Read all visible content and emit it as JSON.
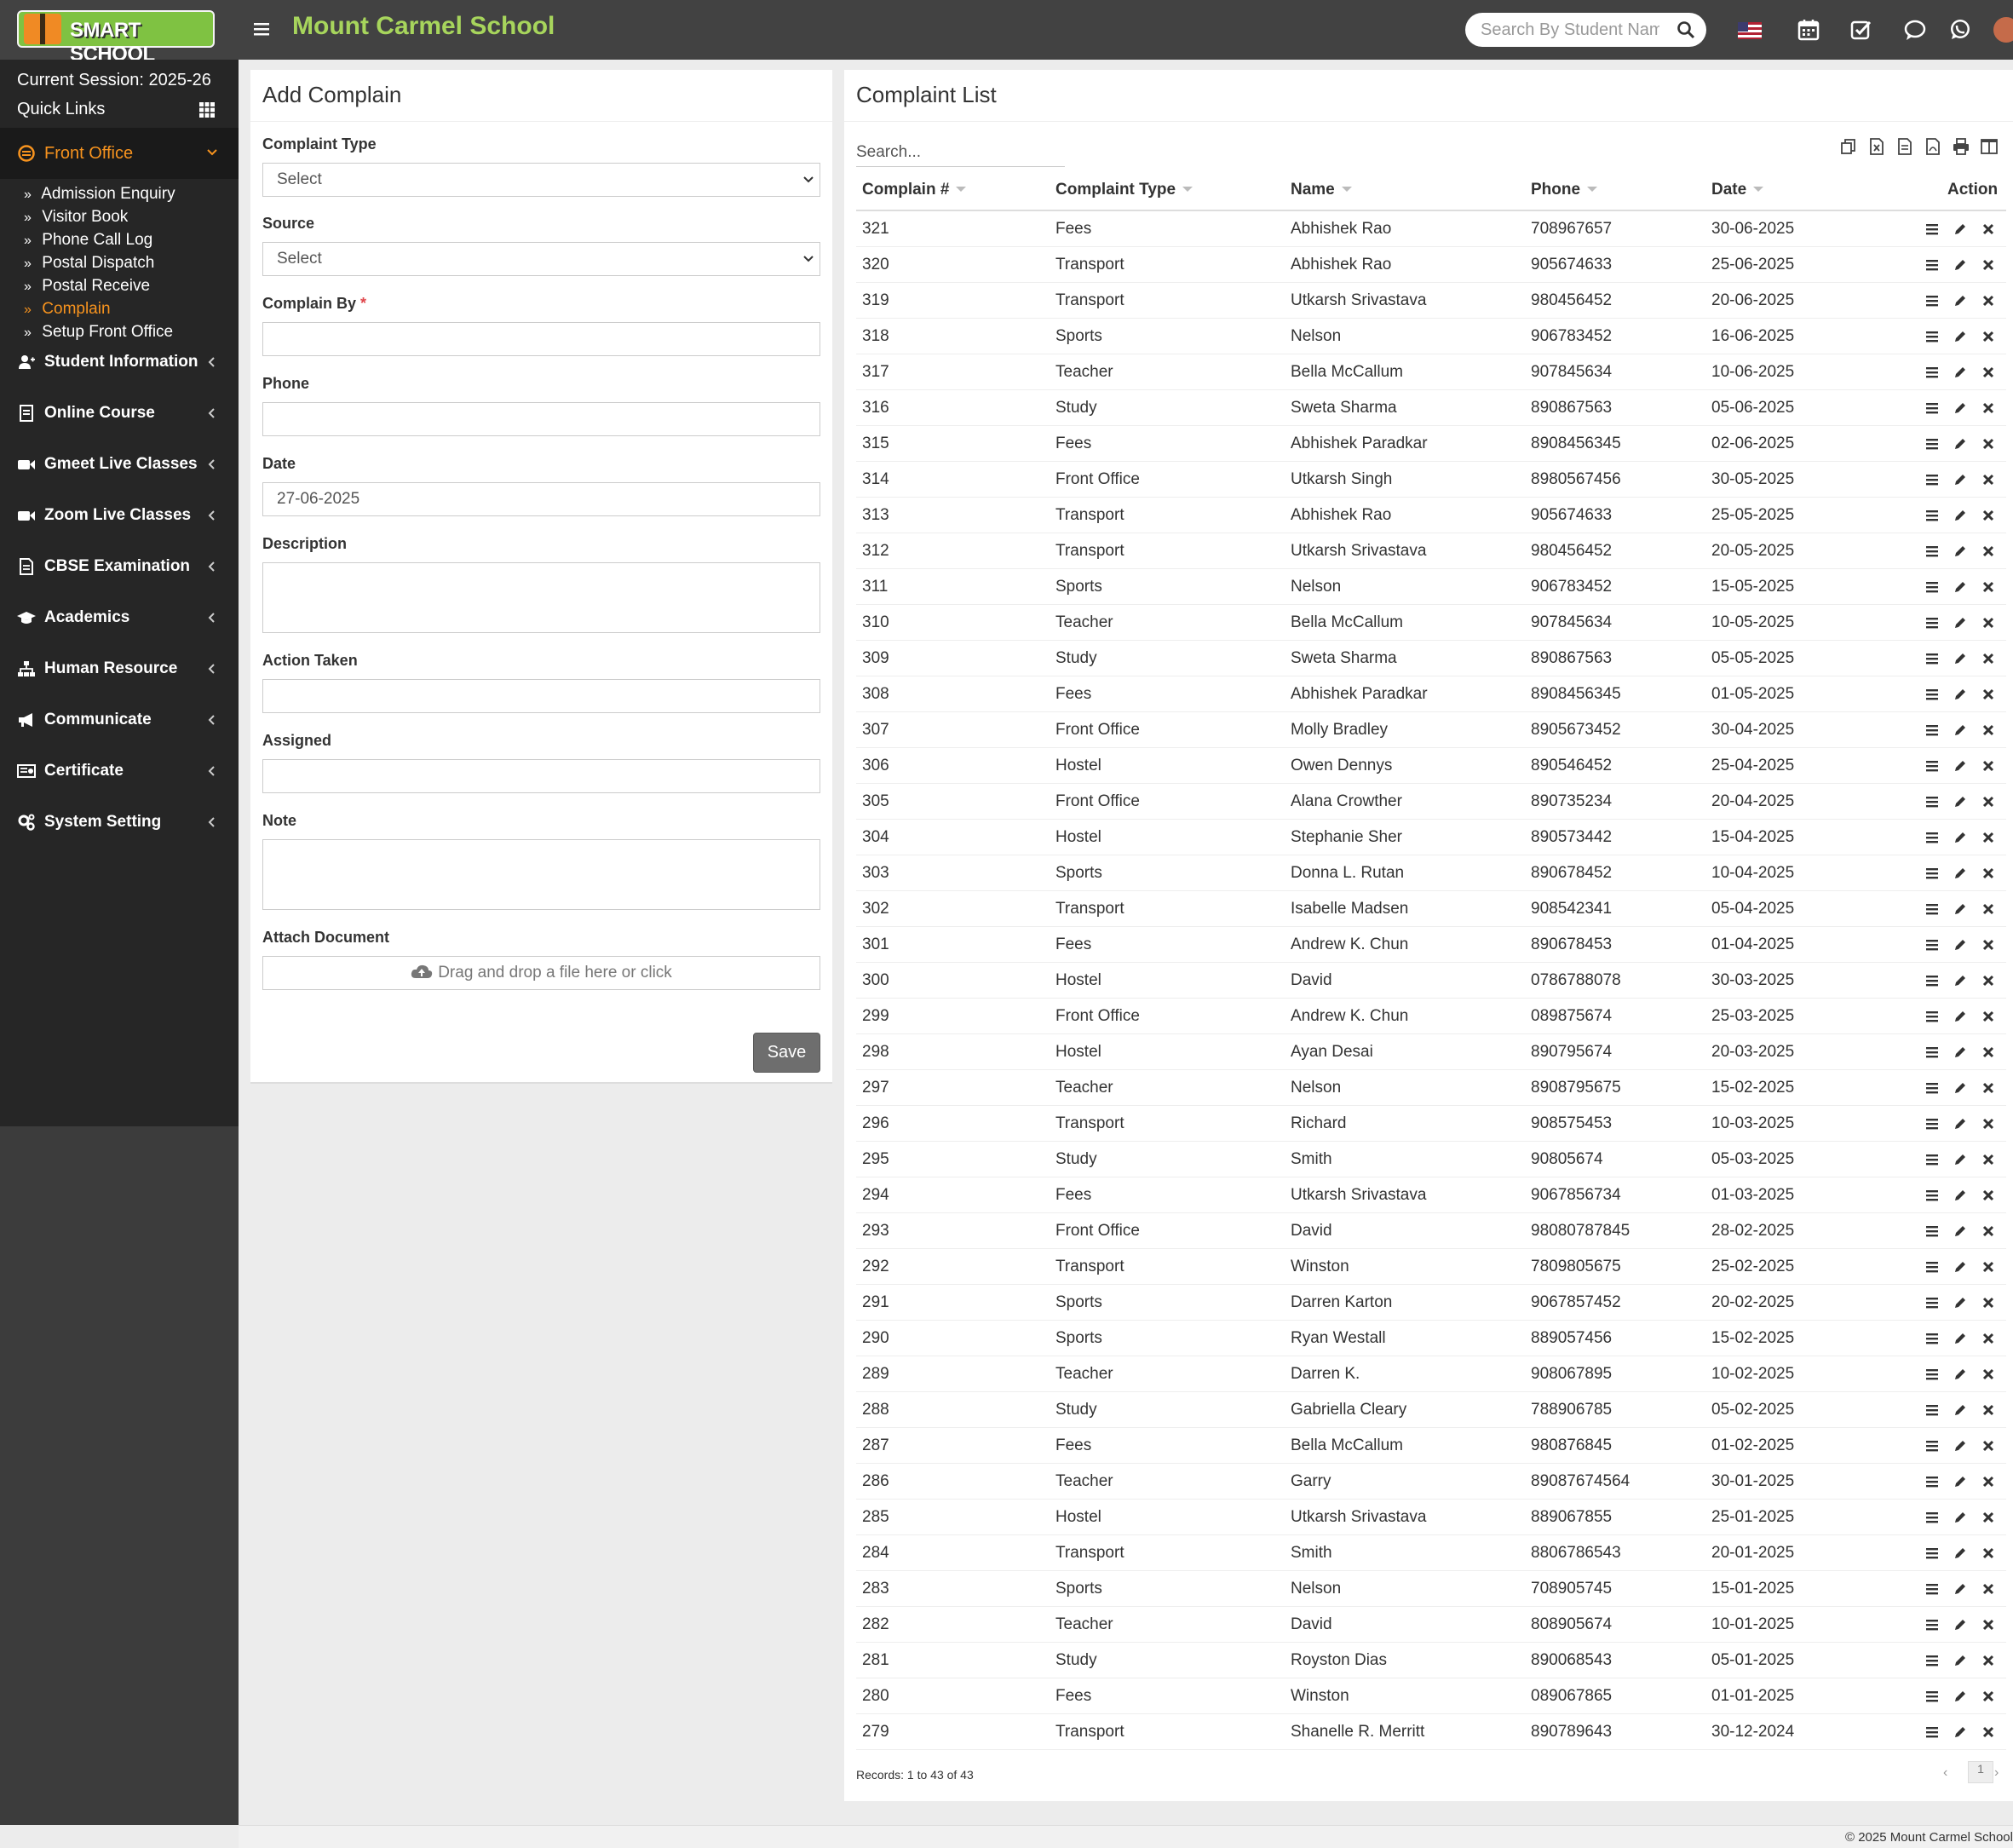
{
  "header": {
    "logo_text": "SMART SCHOOL",
    "school_name": "Mount Carmel School",
    "search_placeholder": "Search By Student Name",
    "icons": [
      "us-flag-icon",
      "calendar-icon",
      "task-check-icon",
      "chat-icon",
      "whatsapp-icon",
      "user-avatar"
    ]
  },
  "sidebar": {
    "session": "Current Session: 2025-26",
    "quick_links": "Quick Links",
    "active_section": "Front Office",
    "submenu": [
      {
        "label": "Admission Enquiry",
        "active": false
      },
      {
        "label": "Visitor Book",
        "active": false
      },
      {
        "label": "Phone Call Log",
        "active": false
      },
      {
        "label": "Postal Dispatch",
        "active": false
      },
      {
        "label": "Postal Receive",
        "active": false
      },
      {
        "label": "Complain",
        "active": true
      },
      {
        "label": "Setup Front Office",
        "active": false
      }
    ],
    "items": [
      {
        "label": "Student Information",
        "icon": "user-plus-icon"
      },
      {
        "label": "Online Course",
        "icon": "course-icon"
      },
      {
        "label": "Gmeet Live Classes",
        "icon": "video-icon"
      },
      {
        "label": "Zoom Live Classes",
        "icon": "video-icon"
      },
      {
        "label": "CBSE Examination",
        "icon": "document-icon"
      },
      {
        "label": "Academics",
        "icon": "graduation-cap-icon"
      },
      {
        "label": "Human Resource",
        "icon": "sitemap-icon"
      },
      {
        "label": "Communicate",
        "icon": "bullhorn-icon"
      },
      {
        "label": "Certificate",
        "icon": "certificate-icon"
      },
      {
        "label": "System Setting",
        "icon": "gears-icon"
      }
    ]
  },
  "form": {
    "title": "Add Complain",
    "complaint_type_label": "Complaint Type",
    "complaint_type_value": "Select",
    "source_label": "Source",
    "source_value": "Select",
    "complain_by_label": "Complain By",
    "required_mark": "*",
    "phone_label": "Phone",
    "date_label": "Date",
    "date_value": "27-06-2025",
    "description_label": "Description",
    "action_taken_label": "Action Taken",
    "assigned_label": "Assigned",
    "note_label": "Note",
    "attach_label": "Attach Document",
    "dropzone_text": "Drag and drop a file here or click",
    "save_label": "Save"
  },
  "list": {
    "title": "Complaint List",
    "search_placeholder": "Search...",
    "toolbar_icons": [
      "copy-icon",
      "excel-icon",
      "csv-icon",
      "pdf-icon",
      "print-icon",
      "columns-icon"
    ],
    "columns": [
      "Complain #",
      "Complaint Type",
      "Name",
      "Phone",
      "Date",
      "Action"
    ],
    "rows": [
      [
        "321",
        "Fees",
        "Abhishek Rao",
        "708967657",
        "30-06-2025"
      ],
      [
        "320",
        "Transport",
        "Abhishek Rao",
        "905674633",
        "25-06-2025"
      ],
      [
        "319",
        "Transport",
        "Utkarsh Srivastava",
        "980456452",
        "20-06-2025"
      ],
      [
        "318",
        "Sports",
        "Nelson",
        "906783452",
        "16-06-2025"
      ],
      [
        "317",
        "Teacher",
        "Bella McCallum",
        "907845634",
        "10-06-2025"
      ],
      [
        "316",
        "Study",
        "Sweta Sharma",
        "890867563",
        "05-06-2025"
      ],
      [
        "315",
        "Fees",
        "Abhishek Paradkar",
        "8908456345",
        "02-06-2025"
      ],
      [
        "314",
        "Front Office",
        "Utkarsh Singh",
        "8980567456",
        "30-05-2025"
      ],
      [
        "313",
        "Transport",
        "Abhishek Rao",
        "905674633",
        "25-05-2025"
      ],
      [
        "312",
        "Transport",
        "Utkarsh Srivastava",
        "980456452",
        "20-05-2025"
      ],
      [
        "311",
        "Sports",
        "Nelson",
        "906783452",
        "15-05-2025"
      ],
      [
        "310",
        "Teacher",
        "Bella McCallum",
        "907845634",
        "10-05-2025"
      ],
      [
        "309",
        "Study",
        "Sweta Sharma",
        "890867563",
        "05-05-2025"
      ],
      [
        "308",
        "Fees",
        "Abhishek Paradkar",
        "8908456345",
        "01-05-2025"
      ],
      [
        "307",
        "Front Office",
        "Molly Bradley",
        "8905673452",
        "30-04-2025"
      ],
      [
        "306",
        "Hostel",
        "Owen Dennys",
        "890546452",
        "25-04-2025"
      ],
      [
        "305",
        "Front Office",
        "Alana Crowther",
        "890735234",
        "20-04-2025"
      ],
      [
        "304",
        "Hostel",
        "Stephanie Sher",
        "890573442",
        "15-04-2025"
      ],
      [
        "303",
        "Sports",
        "Donna L. Rutan",
        "890678452",
        "10-04-2025"
      ],
      [
        "302",
        "Transport",
        "Isabelle Madsen",
        "908542341",
        "05-04-2025"
      ],
      [
        "301",
        "Fees",
        "Andrew K. Chun",
        "890678453",
        "01-04-2025"
      ],
      [
        "300",
        "Hostel",
        "David",
        "0786788078",
        "30-03-2025"
      ],
      [
        "299",
        "Front Office",
        "Andrew K. Chun",
        "089875674",
        "25-03-2025"
      ],
      [
        "298",
        "Hostel",
        "Ayan Desai",
        "890795674",
        "20-03-2025"
      ],
      [
        "297",
        "Teacher",
        "Nelson",
        "8908795675",
        "15-02-2025"
      ],
      [
        "296",
        "Transport",
        "Richard",
        "908575453",
        "10-03-2025"
      ],
      [
        "295",
        "Study",
        "Smith",
        "90805674",
        "05-03-2025"
      ],
      [
        "294",
        "Fees",
        "Utkarsh Srivastava",
        "9067856734",
        "01-03-2025"
      ],
      [
        "293",
        "Front Office",
        "David",
        "98080787845",
        "28-02-2025"
      ],
      [
        "292",
        "Transport",
        "Winston",
        "7809805675",
        "25-02-2025"
      ],
      [
        "291",
        "Sports",
        "Darren Karton",
        "9067857452",
        "20-02-2025"
      ],
      [
        "290",
        "Sports",
        "Ryan Westall",
        "889057456",
        "15-02-2025"
      ],
      [
        "289",
        "Teacher",
        "Darren K.",
        "908067895",
        "10-02-2025"
      ],
      [
        "288",
        "Study",
        "Gabriella Cleary",
        "788906785",
        "05-02-2025"
      ],
      [
        "287",
        "Fees",
        "Bella McCallum",
        "980876845",
        "01-02-2025"
      ],
      [
        "286",
        "Teacher",
        "Garry",
        "89087674564",
        "30-01-2025"
      ],
      [
        "285",
        "Hostel",
        "Utkarsh Srivastava",
        "889067855",
        "25-01-2025"
      ],
      [
        "284",
        "Transport",
        "Smith",
        "8806786543",
        "20-01-2025"
      ],
      [
        "283",
        "Sports",
        "Nelson",
        "708905745",
        "15-01-2025"
      ],
      [
        "282",
        "Teacher",
        "David",
        "808905674",
        "10-01-2025"
      ],
      [
        "281",
        "Study",
        "Royston Dias",
        "890068543",
        "05-01-2025"
      ],
      [
        "280",
        "Fees",
        "Winston",
        "089067865",
        "01-01-2025"
      ],
      [
        "279",
        "Transport",
        "Shanelle R. Merritt",
        "890789643",
        "30-12-2024"
      ]
    ],
    "records_text": "Records: 1 to 43 of 43",
    "prev": "‹",
    "page": "1",
    "next": "›"
  },
  "footer": {
    "copyright": "© 2025 Mount Carmel School"
  },
  "colors": {
    "topbar": "#424242",
    "sidebar": "#262626",
    "accent_orange": "#f7931e",
    "brand_green": "#a7d55c"
  }
}
